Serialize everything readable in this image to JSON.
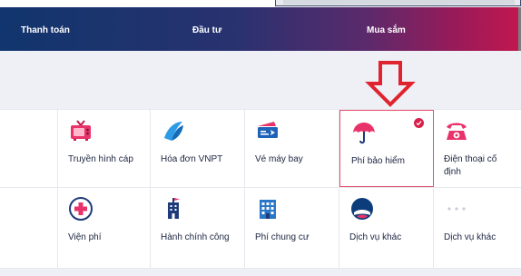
{
  "nav": {
    "tabs": [
      {
        "label": "Thanh toán"
      },
      {
        "label": "Đầu tư"
      },
      {
        "label": "Mua sắm"
      }
    ]
  },
  "services": {
    "row1": [
      {
        "label": "Truyền hình cáp",
        "icon": "tv-icon"
      },
      {
        "label": "Hóa đơn VNPT",
        "icon": "vnpt-logo-icon"
      },
      {
        "label": "Vé máy bay",
        "icon": "plane-ticket-icon"
      },
      {
        "label": "Phí bảo hiểm",
        "icon": "umbrella-icon"
      },
      {
        "label": "Điện thoại cố định",
        "icon": "telephone-icon"
      }
    ],
    "row2": [
      {
        "label": "Viện phí",
        "icon": "hospital-cross-icon"
      },
      {
        "label": "Hành chính công",
        "icon": "government-building-icon"
      },
      {
        "label": "Phí chung cư",
        "icon": "apartment-building-icon"
      },
      {
        "label": "Dịch vụ khác",
        "icon": "other-service-logo-icon"
      },
      {
        "label": "Dịch vụ khác",
        "icon": "more-dots-icon"
      }
    ]
  },
  "colors": {
    "selected_border": "#e5506a",
    "badge": "#d8204a",
    "arrow": "#e0242f"
  }
}
